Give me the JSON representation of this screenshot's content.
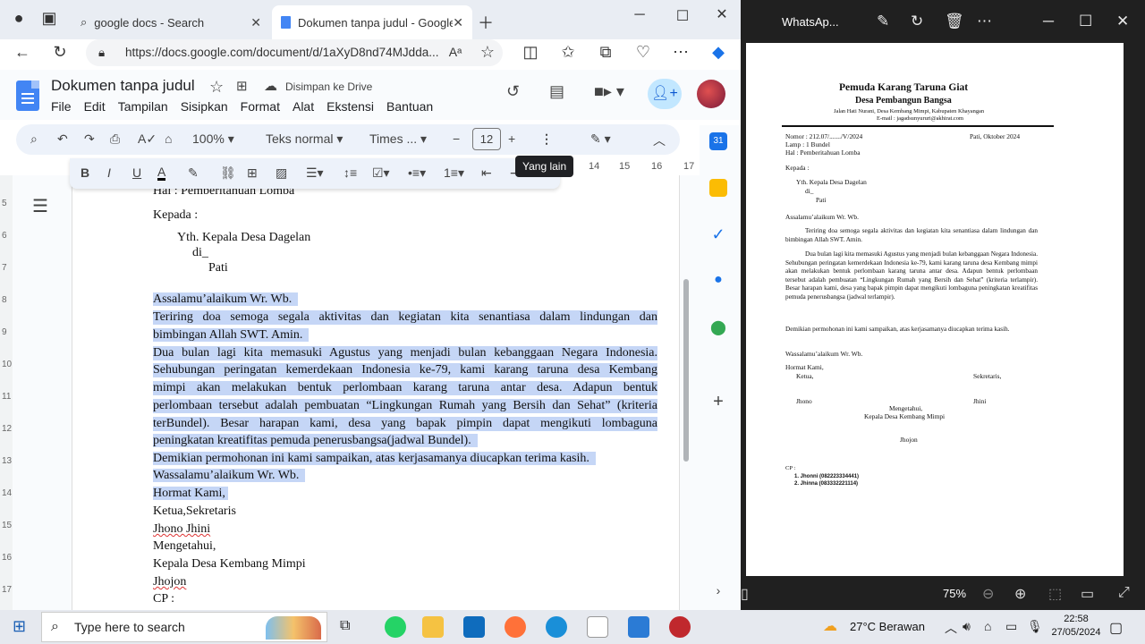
{
  "browser": {
    "tabs": [
      {
        "title": "google docs - Search",
        "active": false
      },
      {
        "title": "Dokumen tanpa judul - Google D",
        "active": true
      }
    ],
    "url": "https://docs.google.com/document/d/1aXyD8nd74MJdda..."
  },
  "docs": {
    "title": "Dokumen tanpa judul",
    "saved_status": "Disimpan ke Drive",
    "menu": [
      "File",
      "Edit",
      "Tampilan",
      "Sisipkan",
      "Format",
      "Alat",
      "Ekstensi",
      "Bantuan"
    ],
    "toolbar": {
      "zoom": "100%",
      "style": "Teks normal",
      "font": "Times ...",
      "font_size": "12"
    },
    "tooltip": "Yang lain",
    "ruler_top": [
      "14",
      "15",
      "16",
      "17"
    ],
    "ruler_left": [
      "5",
      "6",
      "7",
      "8",
      "9",
      "10",
      "11",
      "12",
      "13",
      "14",
      "15",
      "16",
      "17"
    ],
    "body": {
      "hal_line": "Hal          : Pemberitahuan Lomba",
      "kepada": "Kepada :",
      "yth": "Yth. Kepala Desa Dagelan",
      "di": "di_",
      "pati": "Pati",
      "salam": "Assalamu’alaikum  Wr.  Wb.",
      "p1_l1": "Teriring doa semoga segala aktivitas dan kegiatan kita senantiasa dalam lindungan dan",
      "p1_l2": "bimbingan Allah SWT. Amin.",
      "p2_l1": "Dua bulan lagi kita memasuki Agustus yang menjadi bulan kebanggaan Negara Indonesia.",
      "p2_l2": "Sehubungan peringatan kemerdekaan Indonesia ke-79, kami karang taruna desa Kembang",
      "p2_l3": "mimpi akan melakukan bentuk perlombaan karang taruna antar desa. Adapun bentuk",
      "p2_l4": "perlombaan tersebut adalah pembuatan “Lingkungan Rumah yang Bersih dan Sehat” (kriteria",
      "p2_l5": "terBundel). Besar harapan kami, desa yang bapak pimpin dapat mengikuti lombaguna",
      "p2_l6": "peningkatan kreatifitas pemuda penerusbangsa(jadwal Bundel).",
      "p3": "Demikian permohonan ini kami sampaikan, atas kerjasamanya diucapkan terima kasih.",
      "wassalam": "Wassalamu’alaikum  Wr.  Wb.",
      "hormat": "Hormat Kami,",
      "ketua": "Ketua,Sekretaris",
      "names": "Jhono Jhini",
      "mengetahui": "Mengetahui,",
      "kades": "Kepala Desa Kembang Mimpi",
      "jhojon": "Jhojon",
      "cp": "CP :"
    }
  },
  "whatsapp": {
    "title": "WhatsAp...",
    "zoom": "75%",
    "letter": {
      "org1": "Pemuda Karang Taruna Giat",
      "org2": "Desa Pembangun Bangsa",
      "address": "Jalan Hati Nurani, Desa Kembang Mimpi, Kabupaten Khayangan",
      "email": "E-mail : jagadsunyururi@akhirat.com",
      "nomor": "Nomor  : 212.07/......./V/2024",
      "lamp": "Lamp   : 1 Bundel",
      "hal": "Hal       : Pemberitahuan Lomba",
      "date": "Pati,  Oktober 2024",
      "kepada": "Kepada :",
      "yth": "Yth. Kepala Desa Dagelan",
      "di": "di_",
      "pati": "Pati",
      "salam": "Assalamu’alaikum  Wr. Wb.",
      "p1": "Teriring doa semoga segala aktivitas dan kegiatan kita senantiasa dalam lindungan dan bimbingan Allah SWT. Amin.",
      "p2": "Dua bulan lagi kita memasuki Agustus yang menjadi bulan kebanggaan Negara Indonesia. Sehubungan peringatan kemerdekaan Indonesia ke-79, kami karang taruna desa Kembang mimpi akan melakukan bentuk perlombaan karang taruna antar desa. Adapun bentuk perlombaan tersebut adalah pembuatan “Lingkungan Rumah yang Bersih dan Sehat” (kriteria terlampir). Besar harapan kami, desa yang bapak pimpin dapat mengikuti lombaguna peningkatan kreatifitas pemuda penerusbangsa (jadwal terlampir).",
      "p3": "Demikian permohonan ini kami sampaikan, atas kerjasamanya diucapkan terima kasih.",
      "wassalam": "Wassalamu’alaikum  Wr. Wb.",
      "hormat": "Hormat Kami,",
      "ketua": "Ketua,",
      "sekretaris": "Sekretaris,",
      "jhono": "Jhono",
      "jhini": "Jhini",
      "mengetahui": "Mengetahui,",
      "kades": "Kepala Desa Kembang Mimpi",
      "jhojon": "Jhojon",
      "cp": "CP :",
      "cp1": "1.   Jhonni (082223334441)",
      "cp2": "2.   Jhinna (083332221114)"
    }
  },
  "taskbar": {
    "search_placeholder": "Type here to search",
    "weather": "27°C  Berawan",
    "time": "22:58",
    "date": "27/05/2024"
  },
  "colors": {
    "selection": "#c5d6f6",
    "docs_blue": "#4285f4",
    "toolbar_bg": "#edf2fa"
  }
}
